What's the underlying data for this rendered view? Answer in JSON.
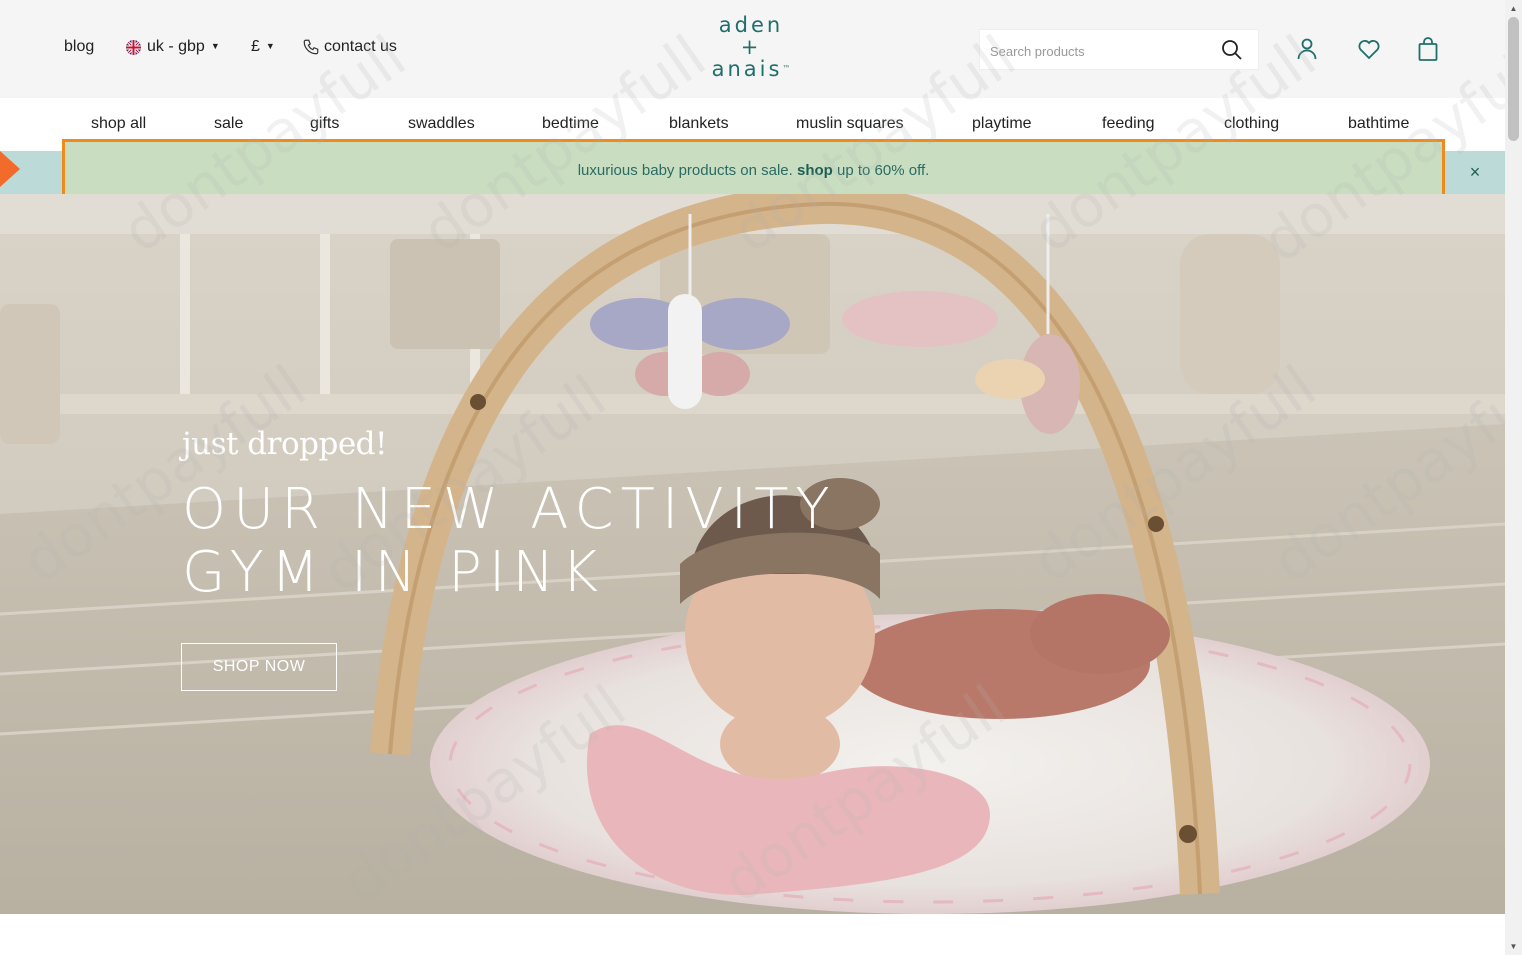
{
  "header": {
    "blog_label": "blog",
    "locale_label": "uk - gbp",
    "currency_label": "£",
    "contact_label": "contact us",
    "logo": {
      "line1": "aden",
      "line2": "+",
      "line3": "anais",
      "tm": "™"
    },
    "search_placeholder": "Search products",
    "icons": [
      "search-icon",
      "account-icon",
      "heart-icon",
      "bag-icon"
    ],
    "accent_color": "#1f6f6b"
  },
  "nav": {
    "items": [
      "shop all",
      "sale",
      "gifts",
      "swaddles",
      "bedtime",
      "blankets",
      "muslin squares",
      "playtime",
      "feeding",
      "clothing",
      "bathtime"
    ]
  },
  "promo": {
    "text_before": "luxurious baby products on sale.",
    "link_text": "shop",
    "text_after": "up to 60% off.",
    "close_label": "×",
    "background_color": "#bcdad8",
    "highlight_color": "#ef8a1c"
  },
  "hero": {
    "kicker": "just dropped!",
    "title_line1": "OUR NEW ACTIVITY",
    "title_line2": "GYM IN PINK",
    "cta_label": "SHOP NOW"
  },
  "watermark": "dontpayfull"
}
